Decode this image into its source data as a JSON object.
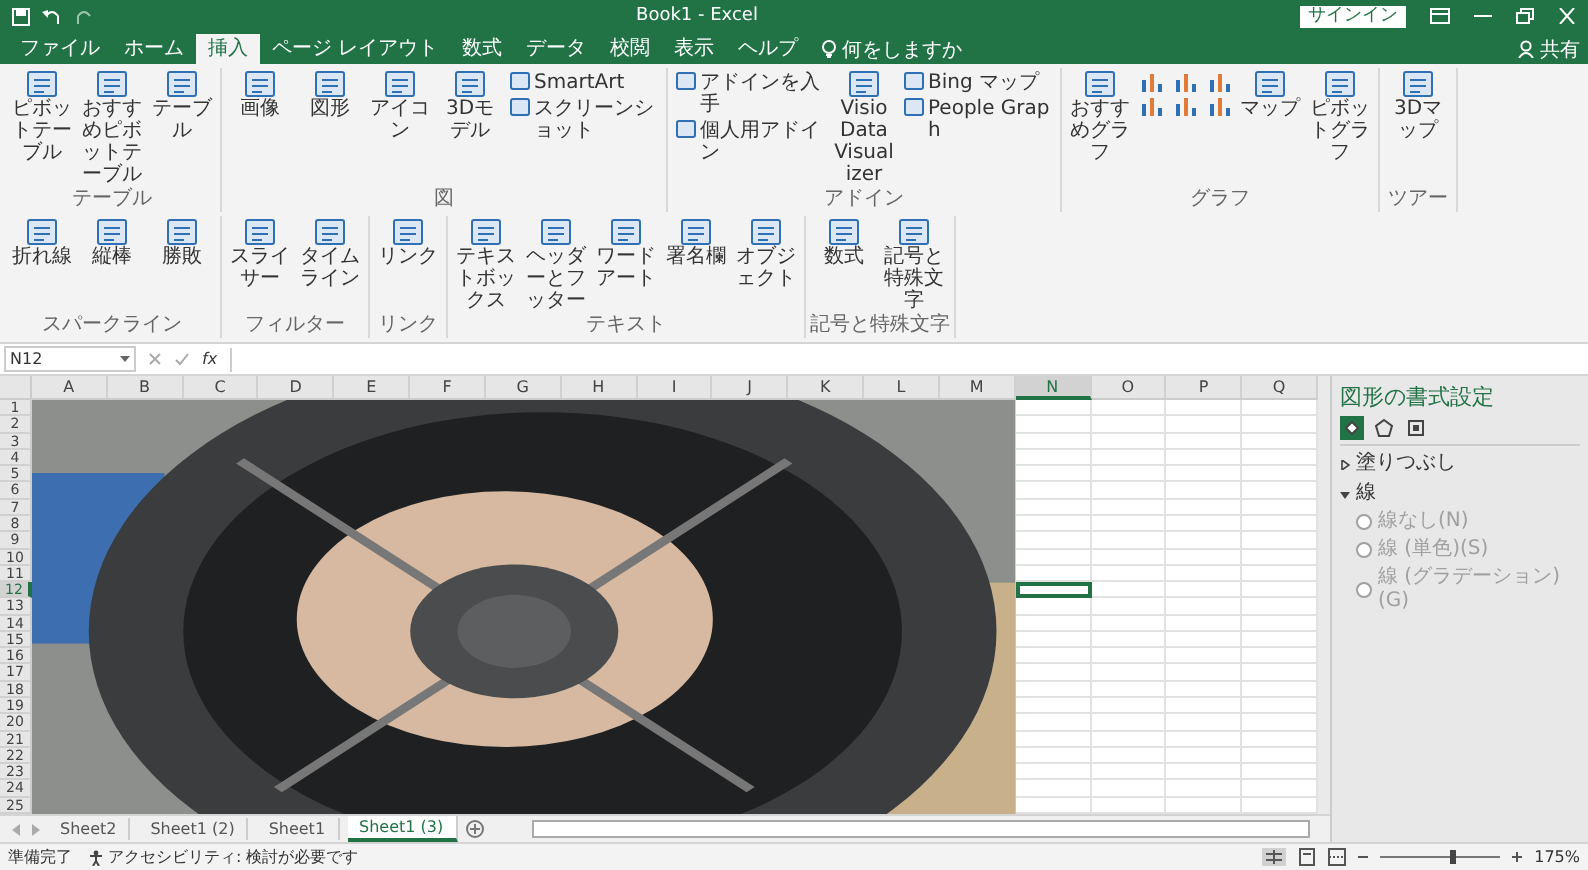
{
  "window": {
    "title": "Book1 - Excel",
    "sign_in": "サインイン",
    "share": "共有"
  },
  "menu_tabs": [
    {
      "label": "ファイル",
      "selected": false
    },
    {
      "label": "ホーム",
      "selected": false
    },
    {
      "label": "挿入",
      "selected": true
    },
    {
      "label": "ページ レイアウト",
      "selected": false
    },
    {
      "label": "数式",
      "selected": false
    },
    {
      "label": "データ",
      "selected": false
    },
    {
      "label": "校閲",
      "selected": false
    },
    {
      "label": "表示",
      "selected": false
    },
    {
      "label": "ヘルプ",
      "selected": false
    }
  ],
  "tell_me": "何をしますか",
  "ribbon_groups": [
    {
      "label": "テーブル",
      "items": [
        {
          "kind": "large",
          "label": "ピボットテーブル"
        },
        {
          "kind": "large",
          "label": "おすすめピボットテーブル"
        },
        {
          "kind": "large",
          "label": "テーブル"
        }
      ]
    },
    {
      "label": "図",
      "items": [
        {
          "kind": "large",
          "label": "画像"
        },
        {
          "kind": "large",
          "label": "図形"
        },
        {
          "kind": "large",
          "label": "アイコン"
        },
        {
          "kind": "large",
          "label": "3Dモデル"
        },
        {
          "kind": "stack",
          "items": [
            "SmartArt",
            "スクリーンショット"
          ]
        }
      ]
    },
    {
      "label": "アドイン",
      "items": [
        {
          "kind": "stack",
          "items": [
            "アドインを入手",
            "個人用アドイン"
          ]
        },
        {
          "kind": "large",
          "label": "Visio Data Visualizer"
        },
        {
          "kind": "stack",
          "items": [
            "Bing マップ",
            "People Graph"
          ]
        }
      ]
    },
    {
      "label": "グラフ",
      "items": [
        {
          "kind": "large",
          "label": "おすすめグラフ"
        },
        {
          "kind": "icon-grid"
        },
        {
          "kind": "large",
          "label": "マップ"
        },
        {
          "kind": "large",
          "label": "ピボットグラフ"
        }
      ]
    },
    {
      "label": "ツアー",
      "items": [
        {
          "kind": "large",
          "label": "3Dマップ"
        }
      ]
    },
    {
      "label": "スパークライン",
      "items": [
        {
          "kind": "large",
          "label": "折れ線"
        },
        {
          "kind": "large",
          "label": "縦棒"
        },
        {
          "kind": "large",
          "label": "勝敗"
        }
      ]
    },
    {
      "label": "フィルター",
      "items": [
        {
          "kind": "large",
          "label": "スライサー"
        },
        {
          "kind": "large",
          "label": "タイムライン"
        }
      ]
    },
    {
      "label": "リンク",
      "items": [
        {
          "kind": "large",
          "label": "リンク"
        }
      ]
    },
    {
      "label": "テキスト",
      "items": [
        {
          "kind": "large",
          "label": "テキストボックス"
        },
        {
          "kind": "large",
          "label": "ヘッダーとフッター"
        },
        {
          "kind": "large",
          "label": "ワードアート"
        },
        {
          "kind": "large",
          "label": "署名欄"
        },
        {
          "kind": "large",
          "label": "オブジェクト"
        }
      ]
    },
    {
      "label": "記号と特殊文字",
      "items": [
        {
          "kind": "large",
          "label": "数式"
        },
        {
          "kind": "large",
          "label": "記号と特殊文字"
        }
      ]
    }
  ],
  "formula_bar": {
    "name_box": "N12",
    "function_label": "fx"
  },
  "columns": [
    {
      "label": "A",
      "selected": false
    },
    {
      "label": "B",
      "selected": false
    },
    {
      "label": "C",
      "selected": false
    },
    {
      "label": "D",
      "selected": false
    },
    {
      "label": "E",
      "selected": false
    },
    {
      "label": "F",
      "selected": false
    },
    {
      "label": "G",
      "selected": false
    },
    {
      "label": "H",
      "selected": false
    },
    {
      "label": "I",
      "selected": false
    },
    {
      "label": "J",
      "selected": false
    },
    {
      "label": "K",
      "selected": false
    },
    {
      "label": "L",
      "selected": false
    },
    {
      "label": "M",
      "selected": false
    },
    {
      "label": "N",
      "selected": true
    },
    {
      "label": "O",
      "selected": false
    },
    {
      "label": "P",
      "selected": false
    },
    {
      "label": "Q",
      "selected": false
    }
  ],
  "rows": [
    {
      "label": "1",
      "selected": false
    },
    {
      "label": "2",
      "selected": false
    },
    {
      "label": "3",
      "selected": false
    },
    {
      "label": "4",
      "selected": false
    },
    {
      "label": "5",
      "selected": false
    },
    {
      "label": "6",
      "selected": false
    },
    {
      "label": "7",
      "selected": false
    },
    {
      "label": "8",
      "selected": false
    },
    {
      "label": "9",
      "selected": false
    },
    {
      "label": "10",
      "selected": false
    },
    {
      "label": "11",
      "selected": false
    },
    {
      "label": "12",
      "selected": true
    },
    {
      "label": "13",
      "selected": false
    },
    {
      "label": "14",
      "selected": false
    },
    {
      "label": "15",
      "selected": false
    },
    {
      "label": "16",
      "selected": false
    },
    {
      "label": "17",
      "selected": false
    },
    {
      "label": "18",
      "selected": false
    },
    {
      "label": "19",
      "selected": false
    },
    {
      "label": "20",
      "selected": false
    },
    {
      "label": "21",
      "selected": false
    },
    {
      "label": "22",
      "selected": false
    },
    {
      "label": "23",
      "selected": false
    },
    {
      "label": "24",
      "selected": false
    },
    {
      "label": "25",
      "selected": false
    }
  ],
  "format_pane": {
    "title": "図形の書式設定",
    "tabs": [
      {
        "kind": "fill",
        "selected": true
      },
      {
        "kind": "effects",
        "selected": false
      },
      {
        "kind": "size",
        "selected": false
      }
    ],
    "sections": [
      {
        "label": "塗りつぶし",
        "expanded": false
      },
      {
        "label": "線",
        "expanded": true,
        "options": [
          {
            "label": "線なし(N)",
            "disabled": true
          },
          {
            "label": "線 (単色)(S)",
            "disabled": true
          },
          {
            "label": "線 (グラデーション)(G)",
            "disabled": true
          }
        ]
      }
    ]
  },
  "sheet_tabs": [
    {
      "label": "Sheet2",
      "selected": false
    },
    {
      "label": "Sheet1 (2)",
      "selected": false
    },
    {
      "label": "Sheet1",
      "selected": false
    },
    {
      "label": "Sheet1 (3)",
      "selected": true
    }
  ],
  "status_bar": {
    "ready": "準備完了",
    "accessibility": "アクセシビリティ: 検討が必要です",
    "zoom": "175%",
    "zoom_slider": {
      "level": 0.6
    }
  }
}
